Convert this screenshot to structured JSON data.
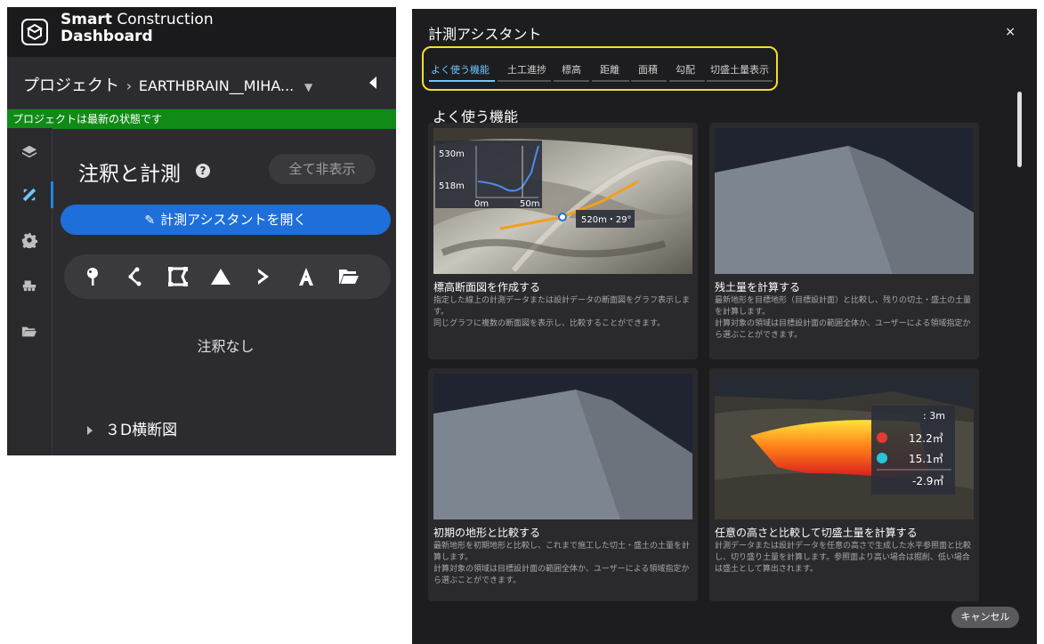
{
  "brand": {
    "name_bold": "Smart",
    "name_rest": " Construction",
    "name_line2": "Dashboard"
  },
  "project": {
    "label": "プロジェクト",
    "separator": "›",
    "name": "EARTHBRAIN__MIHA...",
    "status": "プロジェクトは最新の状態です"
  },
  "rail": {
    "icons": [
      "layers-icon",
      "measure-tools-icon",
      "gear-icon",
      "machine-icon",
      "folder-icon"
    ],
    "active": 1
  },
  "annotations": {
    "title": "注釈と計測",
    "help": "?",
    "hide_all": "全て非表示",
    "open_assistant": "計測アシスタントを開く",
    "tools": [
      "point-pin-icon",
      "polyline-icon",
      "polygon-icon",
      "volume-icon",
      "arrow-icon",
      "text-icon",
      "folder-icon"
    ],
    "empty": "注釈なし",
    "cross_section": "３D横断図"
  },
  "dialog": {
    "title": "計測アシスタント",
    "close": "×",
    "tabs": [
      "よく使う機能",
      "土工進捗",
      "標高",
      "距離",
      "面積",
      "勾配",
      "切盛土量表示"
    ],
    "active_tab": 0,
    "section_title": "よく使う機能",
    "cards": [
      {
        "title": "標高断面図を作成する",
        "desc": "指定した線上の計測データまたは設計データの断面図をグラフ表示します。\n同じグラフに複数の断面図を表示し、比較することができます。",
        "graph": {
          "y_labels": [
            "530m",
            "518m"
          ],
          "x_labels": [
            "0m",
            "50m"
          ],
          "callout": "520m・29°"
        }
      },
      {
        "title": "残土量を計算する",
        "desc": "最新地形を目標地形（目標設計面）と比較し、残りの切土・盛土の土量を計算します。\n計算対象の領域は目標設計面の範囲全体か、ユーザーによる領域指定から選ぶことができます。"
      },
      {
        "title": "初期の地形と比較する",
        "desc": "最新地形を初期地形と比較し、これまで施工した切土・盛土の土量を計算します。\n計算対象の領域は目標設計面の範囲全体か、ユーザーによる領域指定から選ぶことができます。"
      },
      {
        "title": "任意の高さと比較して切盛土量を計算する",
        "desc": "計測データまたは設計データを任意の高さで生成した水平参照面と比較し、切り盛り土量を計算します。参照面より高い場合は掘削、低い場合は盛土として算出されます。",
        "panel": {
          "height": ": 3m",
          "cut": "12.2㎥",
          "fill": "15.1㎥",
          "net": "-2.9㎥"
        }
      }
    ],
    "cancel": "キャンセル"
  },
  "colors": {
    "accent": "#1e6fd9",
    "status_green": "#118a18",
    "highlight": "#f2df2b",
    "cut_red": "#e53935",
    "fill_cyan": "#26c6da"
  }
}
